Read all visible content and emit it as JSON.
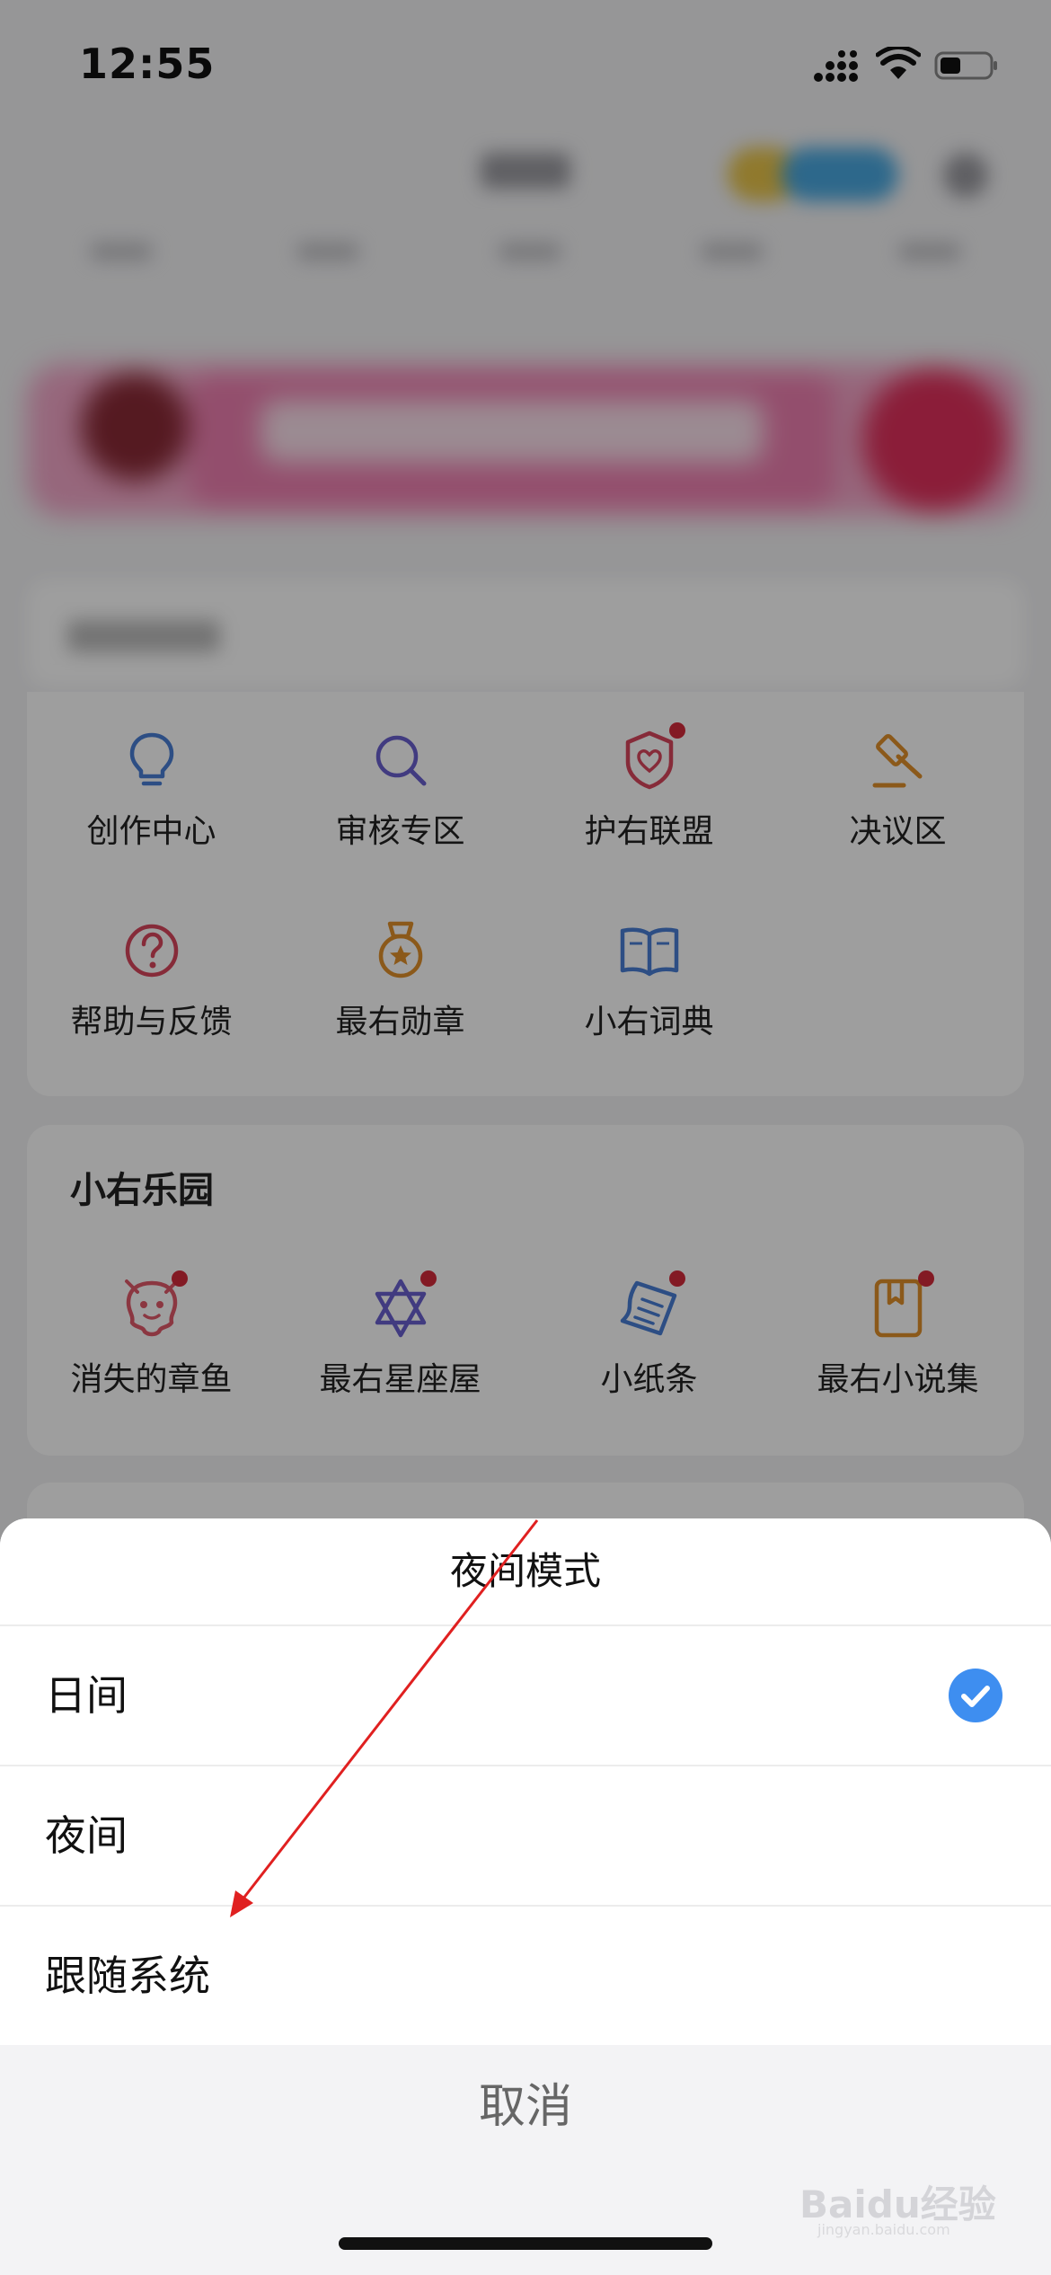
{
  "status_bar": {
    "time": "12:55"
  },
  "tools": {
    "items": [
      {
        "label": "创作中心",
        "icon": "lightbulb-icon",
        "color": "#4a7fd6",
        "badge": false
      },
      {
        "label": "审核专区",
        "icon": "search-icon",
        "color": "#6a5fcf",
        "badge": false
      },
      {
        "label": "护右联盟",
        "icon": "shield-heart-icon",
        "color": "#d8465c",
        "badge": true
      },
      {
        "label": "决议区",
        "icon": "gavel-icon",
        "color": "#e0902a",
        "badge": false
      },
      {
        "label": "帮助与反馈",
        "icon": "help-circle-icon",
        "color": "#d8465c",
        "badge": false
      },
      {
        "label": "最右勋章",
        "icon": "medal-icon",
        "color": "#e0902a",
        "badge": false
      },
      {
        "label": "小右词典",
        "icon": "book-icon",
        "color": "#4a7fd6",
        "badge": false
      }
    ]
  },
  "park": {
    "title": "小右乐园",
    "items": [
      {
        "label": "消失的章鱼",
        "icon": "octopus-icon",
        "color": "#e0596a",
        "badge": true
      },
      {
        "label": "最右星座屋",
        "icon": "star-of-david-icon",
        "color": "#6a5fcf",
        "badge": true
      },
      {
        "label": "小纸条",
        "icon": "paper-note-icon",
        "color": "#4a7fd6",
        "badge": true
      },
      {
        "label": "最右小说集",
        "icon": "novel-book-icon",
        "color": "#e0902a",
        "badge": true
      }
    ]
  },
  "sheet": {
    "title": "夜间模式",
    "options": [
      {
        "label": "日间",
        "selected": true
      },
      {
        "label": "夜间",
        "selected": false
      },
      {
        "label": "跟随系统",
        "selected": false
      }
    ],
    "cancel": "取消",
    "check_color": "#3e8ef0"
  },
  "watermark": {
    "text": "Baidu经验",
    "sub": "jingyan.baidu.com"
  },
  "annotation": {
    "arrow_color": "#e02020"
  }
}
